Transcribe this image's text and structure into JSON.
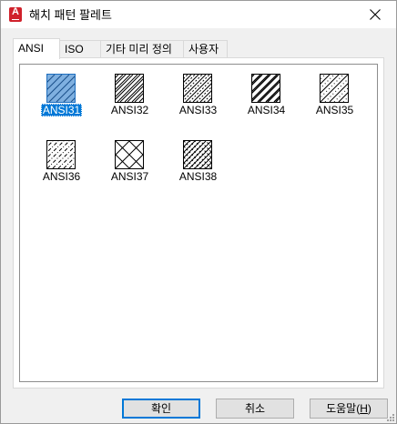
{
  "window": {
    "title": "해치 패턴 팔레트"
  },
  "tabs": [
    {
      "label": "ANSI",
      "active": true
    },
    {
      "label": "ISO",
      "active": false
    },
    {
      "label": "기타 미리 정의",
      "active": false
    },
    {
      "label": "사용자",
      "active": false
    }
  ],
  "patterns": [
    {
      "name": "ANSI31",
      "selected": true
    },
    {
      "name": "ANSI32",
      "selected": false
    },
    {
      "name": "ANSI33",
      "selected": false
    },
    {
      "name": "ANSI34",
      "selected": false
    },
    {
      "name": "ANSI35",
      "selected": false
    },
    {
      "name": "ANSI36",
      "selected": false
    },
    {
      "name": "ANSI37",
      "selected": false
    },
    {
      "name": "ANSI38",
      "selected": false
    }
  ],
  "buttons": {
    "ok": "확인",
    "cancel": "취소",
    "help_prefix": "도움말(",
    "help_mnemonic": "H",
    "help_suffix": ")"
  },
  "colors": {
    "selection": "#0078d7",
    "accent": "#d0212b"
  },
  "icons": {
    "app": "autocad-icon",
    "close": "close-icon"
  }
}
